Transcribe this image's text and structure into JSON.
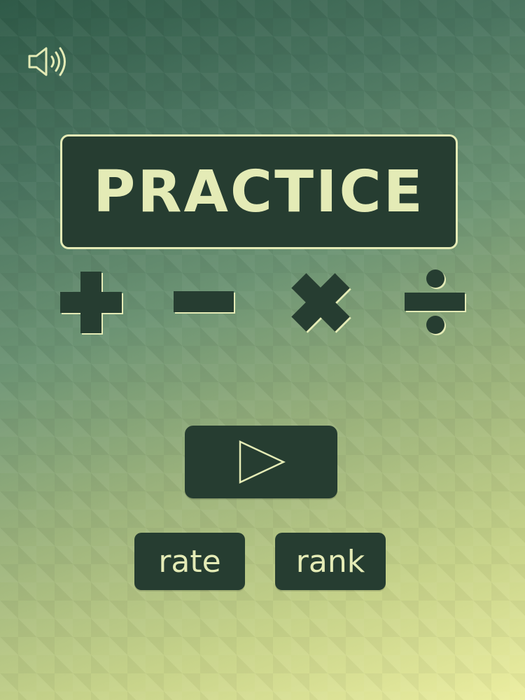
{
  "title": "PRACTICE",
  "operations": [
    {
      "id": "add",
      "icon": "plus-icon"
    },
    {
      "id": "subtract",
      "icon": "minus-icon"
    },
    {
      "id": "multiply",
      "icon": "multiply-icon"
    },
    {
      "id": "divide",
      "icon": "divide-icon"
    }
  ],
  "buttons": {
    "play_icon": "play-icon",
    "rate_label": "rate",
    "rank_label": "rank"
  },
  "sound": {
    "icon": "speaker-icon"
  },
  "colors": {
    "panel": "#263d31",
    "accent": "#e4ebb6",
    "background_top": "#2f5a48",
    "background_bottom": "#eceea0"
  }
}
